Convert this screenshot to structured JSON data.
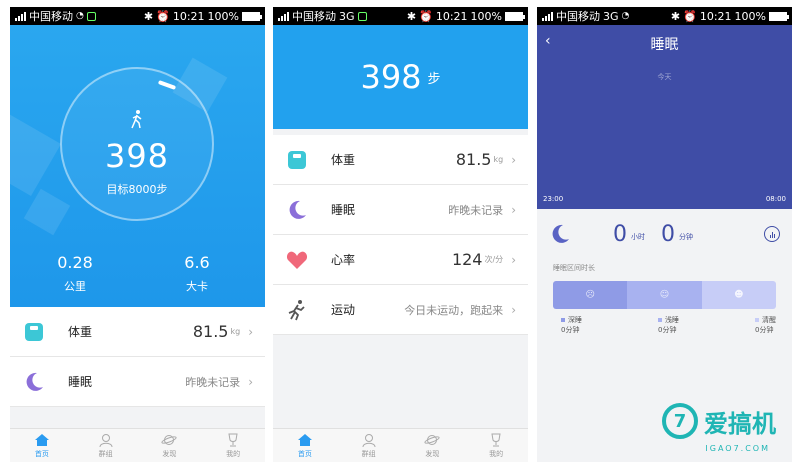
{
  "status_bar": {
    "carrier": "中国移动",
    "network": "3G",
    "time": "10:21",
    "battery": "100%"
  },
  "screen1": {
    "steps": "398",
    "goal": "目标8000步",
    "distance_value": "0.28",
    "distance_label": "公里",
    "calories_value": "6.6",
    "calories_label": "大卡",
    "rows": [
      {
        "label": "体重",
        "value": "81.5",
        "unit": "kg",
        "sub": ""
      },
      {
        "label": "睡眠",
        "value": "",
        "unit": "",
        "sub": "昨晚未记录"
      }
    ]
  },
  "screen2": {
    "steps": "398",
    "steps_unit": "步",
    "rows": [
      {
        "label": "体重",
        "value": "81.5",
        "unit": "kg",
        "sub": ""
      },
      {
        "label": "睡眠",
        "value": "",
        "unit": "",
        "sub": "昨晚未记录"
      },
      {
        "label": "心率",
        "value": "124",
        "unit": "次/分",
        "sub": ""
      },
      {
        "label": "运动",
        "value": "",
        "unit": "",
        "sub": "今日未运动，跑起来"
      }
    ]
  },
  "screen3": {
    "title": "睡眠",
    "back": "‹",
    "today": "今天",
    "start_time": "23:00",
    "end_time": "08:00",
    "hours": "0",
    "hours_unit": "小时",
    "minutes": "0",
    "minutes_unit": "分钟",
    "duration_title": "睡眠区间时长",
    "legend": [
      {
        "label": "深睡",
        "value": "0分钟",
        "color": "#8f9be6"
      },
      {
        "label": "浅睡",
        "value": "0分钟",
        "color": "#a8b2f0"
      },
      {
        "label": "清醒",
        "value": "0分钟",
        "color": "#c7cdf7"
      }
    ]
  },
  "tabbar": {
    "home": "首页",
    "group": "群组",
    "discover": "发现",
    "mine": "我的"
  },
  "watermark": {
    "brand": "爱搞机",
    "site": "IGAO7.COM"
  },
  "colors": {
    "primary": "#22a1ee",
    "sleep": "#3f4da6",
    "accent_watermark": "#1fb5b4"
  }
}
